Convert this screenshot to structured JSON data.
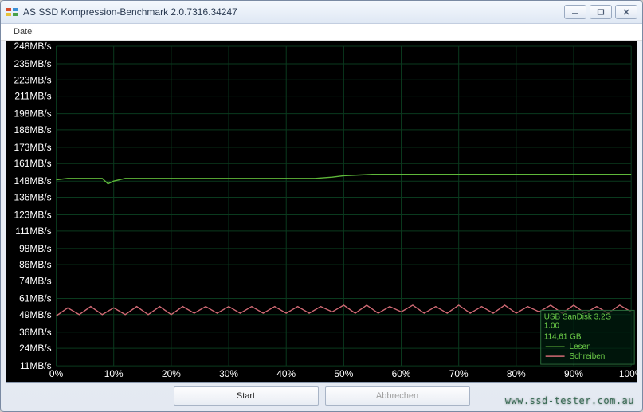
{
  "window": {
    "title": "AS SSD Kompression-Benchmark 2.0.7316.34247",
    "minimize": "—",
    "maximize": "□",
    "close": "✕"
  },
  "menu": {
    "file": "Datei"
  },
  "buttons": {
    "start": "Start",
    "cancel": "Abbrechen"
  },
  "watermark": "www.ssd-tester.com.au",
  "device": {
    "l1": "USB  SanDisk 3.2G",
    "l2": "1.00",
    "l3": "114,61 GB"
  },
  "legend": {
    "read": "Lesen",
    "write": "Schreiben"
  },
  "chart_data": {
    "type": "line",
    "title": "",
    "xlabel": "",
    "ylabel": "",
    "xlim": [
      0,
      100
    ],
    "ylim": [
      11,
      248
    ],
    "x_ticks": [
      0,
      10,
      20,
      30,
      40,
      50,
      60,
      70,
      80,
      90,
      100
    ],
    "x_tick_labels": [
      "0%",
      "10%",
      "20%",
      "30%",
      "40%",
      "50%",
      "60%",
      "70%",
      "80%",
      "90%",
      "100%"
    ],
    "y_ticks": [
      11,
      24,
      36,
      49,
      61,
      74,
      86,
      98,
      111,
      123,
      136,
      148,
      161,
      173,
      186,
      198,
      211,
      223,
      235,
      248
    ],
    "y_tick_labels": [
      "11MB/s",
      "24MB/s",
      "36MB/s",
      "49MB/s",
      "61MB/s",
      "74MB/s",
      "86MB/s",
      "98MB/s",
      "111MB/s",
      "123MB/s",
      "136MB/s",
      "148MB/s",
      "161MB/s",
      "173MB/s",
      "186MB/s",
      "198MB/s",
      "211MB/s",
      "223MB/s",
      "235MB/s",
      "248MB/s"
    ],
    "series": [
      {
        "name": "Lesen",
        "color": "#5fb83a",
        "x": [
          0,
          2,
          4,
          6,
          8,
          9,
          10,
          12,
          14,
          16,
          18,
          20,
          25,
          30,
          35,
          40,
          45,
          48,
          50,
          55,
          60,
          65,
          70,
          75,
          80,
          85,
          90,
          95,
          100
        ],
        "y": [
          149,
          150,
          150,
          150,
          150,
          146,
          148,
          150,
          150,
          150,
          150,
          150,
          150,
          150,
          150,
          150,
          150,
          151,
          152,
          153,
          153,
          153,
          153,
          153,
          153,
          153,
          153,
          153,
          153
        ]
      },
      {
        "name": "Schreiben",
        "color": "#d06a74",
        "x": [
          0,
          2,
          4,
          6,
          8,
          10,
          12,
          14,
          16,
          18,
          20,
          22,
          24,
          26,
          28,
          30,
          32,
          34,
          36,
          38,
          40,
          42,
          44,
          46,
          48,
          50,
          52,
          54,
          56,
          58,
          60,
          62,
          64,
          66,
          68,
          70,
          72,
          74,
          76,
          78,
          80,
          82,
          84,
          86,
          88,
          90,
          92,
          94,
          96,
          98,
          100
        ],
        "y": [
          48,
          54,
          49,
          55,
          49,
          54,
          49,
          55,
          49,
          55,
          49,
          55,
          50,
          55,
          50,
          55,
          50,
          55,
          50,
          55,
          50,
          55,
          50,
          55,
          51,
          56,
          50,
          56,
          50,
          55,
          51,
          56,
          50,
          55,
          50,
          56,
          50,
          55,
          50,
          56,
          50,
          55,
          51,
          56,
          50,
          56,
          50,
          55,
          50,
          56,
          51
        ]
      }
    ]
  }
}
